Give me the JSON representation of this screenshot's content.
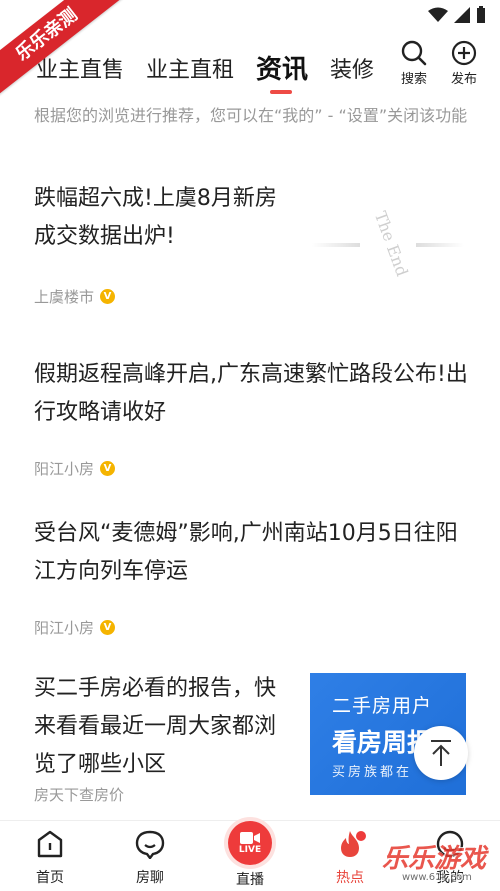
{
  "ribbon": "乐乐亲测",
  "nav": {
    "tabs": [
      "业主直售",
      "业主直租",
      "资讯",
      "装修"
    ],
    "active_tab": "资讯",
    "search_label": "搜索",
    "publish_label": "发布"
  },
  "tip": "根据您的浏览进行推荐，您可以在“我的” - “设置”关闭该功能",
  "articles": [
    {
      "title": "跌幅超六成!上虞8月新房成交数据出炉!",
      "source": "上虞楼市"
    },
    {
      "title": "假期返程高峰开启,广东高速繁忙路段公布!出行攻略请收好",
      "source": "阳江小房"
    },
    {
      "title": "受台风“麦德姆”影响,广州南站10月5日往阳江方向列车停运",
      "source": "阳江小房"
    },
    {
      "title": "买二手房必看的报告，快来看看最近一周大家都浏览了哪些小区",
      "source": "房天下查房价"
    }
  ],
  "thumb_end_text": "The End",
  "ad": {
    "line1": "二手房用户",
    "line2": "看房周报",
    "line3": "买房族都在"
  },
  "bottom_nav": [
    {
      "label": "首页",
      "icon": "home-icon"
    },
    {
      "label": "房聊",
      "icon": "chat-icon"
    },
    {
      "label": "直播",
      "icon": "live-icon",
      "badge_text": "LIVE"
    },
    {
      "label": "热点",
      "icon": "flame-icon",
      "active": true
    },
    {
      "label": "我的",
      "icon": "user-icon"
    }
  ],
  "watermark": {
    "text": "乐乐游戏",
    "sub": "www.61k.com"
  },
  "colors": {
    "accent": "#ee4b45",
    "ad_blue": "#2f7fe6",
    "badge": "#f5b400"
  }
}
